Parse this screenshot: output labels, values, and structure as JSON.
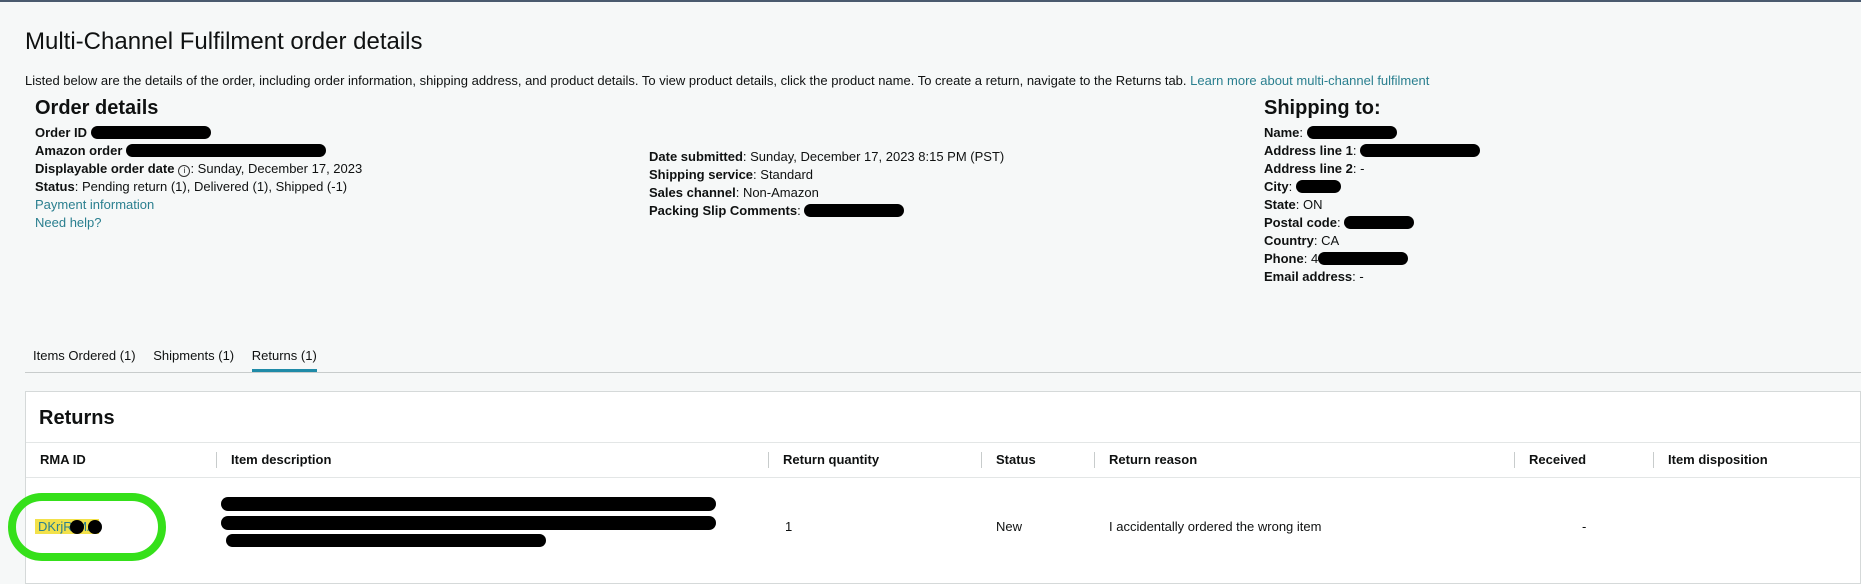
{
  "page": {
    "title": "Multi-Channel Fulfilment order details",
    "intro": "Listed below are the details of the order, including order information, shipping address, and product details. To view product details, click the product name. To create a return, navigate to the Returns tab.",
    "intro_link": "Learn more about multi-channel fulfilment"
  },
  "order": {
    "heading": "Order details",
    "order_id_label": "Order ID",
    "amazon_order_label": "Amazon order",
    "displayable_date_label": "Displayable order date",
    "displayable_date_value": ": Sunday, December 17, 2023",
    "status_label": "Status",
    "status_value": ": Pending return (1), Delivered (1), Shipped (-1)",
    "payment_link": "Payment information",
    "help_link": "Need help?"
  },
  "meta": {
    "date_label": "Date submitted",
    "date_value": ": Sunday, December 17, 2023 8:15 PM (PST)",
    "service_label": "Shipping service",
    "service_value": ": Standard",
    "channel_label": "Sales channel",
    "channel_value": ": Non-Amazon",
    "packing_label": "Packing Slip Comments"
  },
  "shipping": {
    "heading": "Shipping to:",
    "name_label": "Name",
    "addr1_label": "Address line 1",
    "addr2_label": "Address line 2",
    "addr2_value": ": -",
    "city_label": "City",
    "state_label": "State",
    "state_value": ": ON",
    "postal_label": "Postal code",
    "country_label": "Country",
    "country_value": ": CA",
    "phone_label": "Phone",
    "phone_value": ": 4",
    "email_label": "Email address",
    "email_value": ": -"
  },
  "tabs": [
    {
      "label": "Items Ordered (1)"
    },
    {
      "label": "Shipments (1)"
    },
    {
      "label": "Returns (1)"
    }
  ],
  "returns": {
    "heading": "Returns",
    "columns": [
      "RMA ID",
      "Item description",
      "Return quantity",
      "Status",
      "Return reason",
      "Received",
      "Item disposition"
    ],
    "row": {
      "rma_id": "DKrjR   MA",
      "quantity": "1",
      "status": "New",
      "reason": "I accidentally ordered the wrong item",
      "received": "-"
    }
  },
  "colors": {
    "link": "#2a7f8f",
    "tab_active": "#1f8ba8",
    "highlight": "#f2e14a",
    "annotation": "#35e01a"
  }
}
